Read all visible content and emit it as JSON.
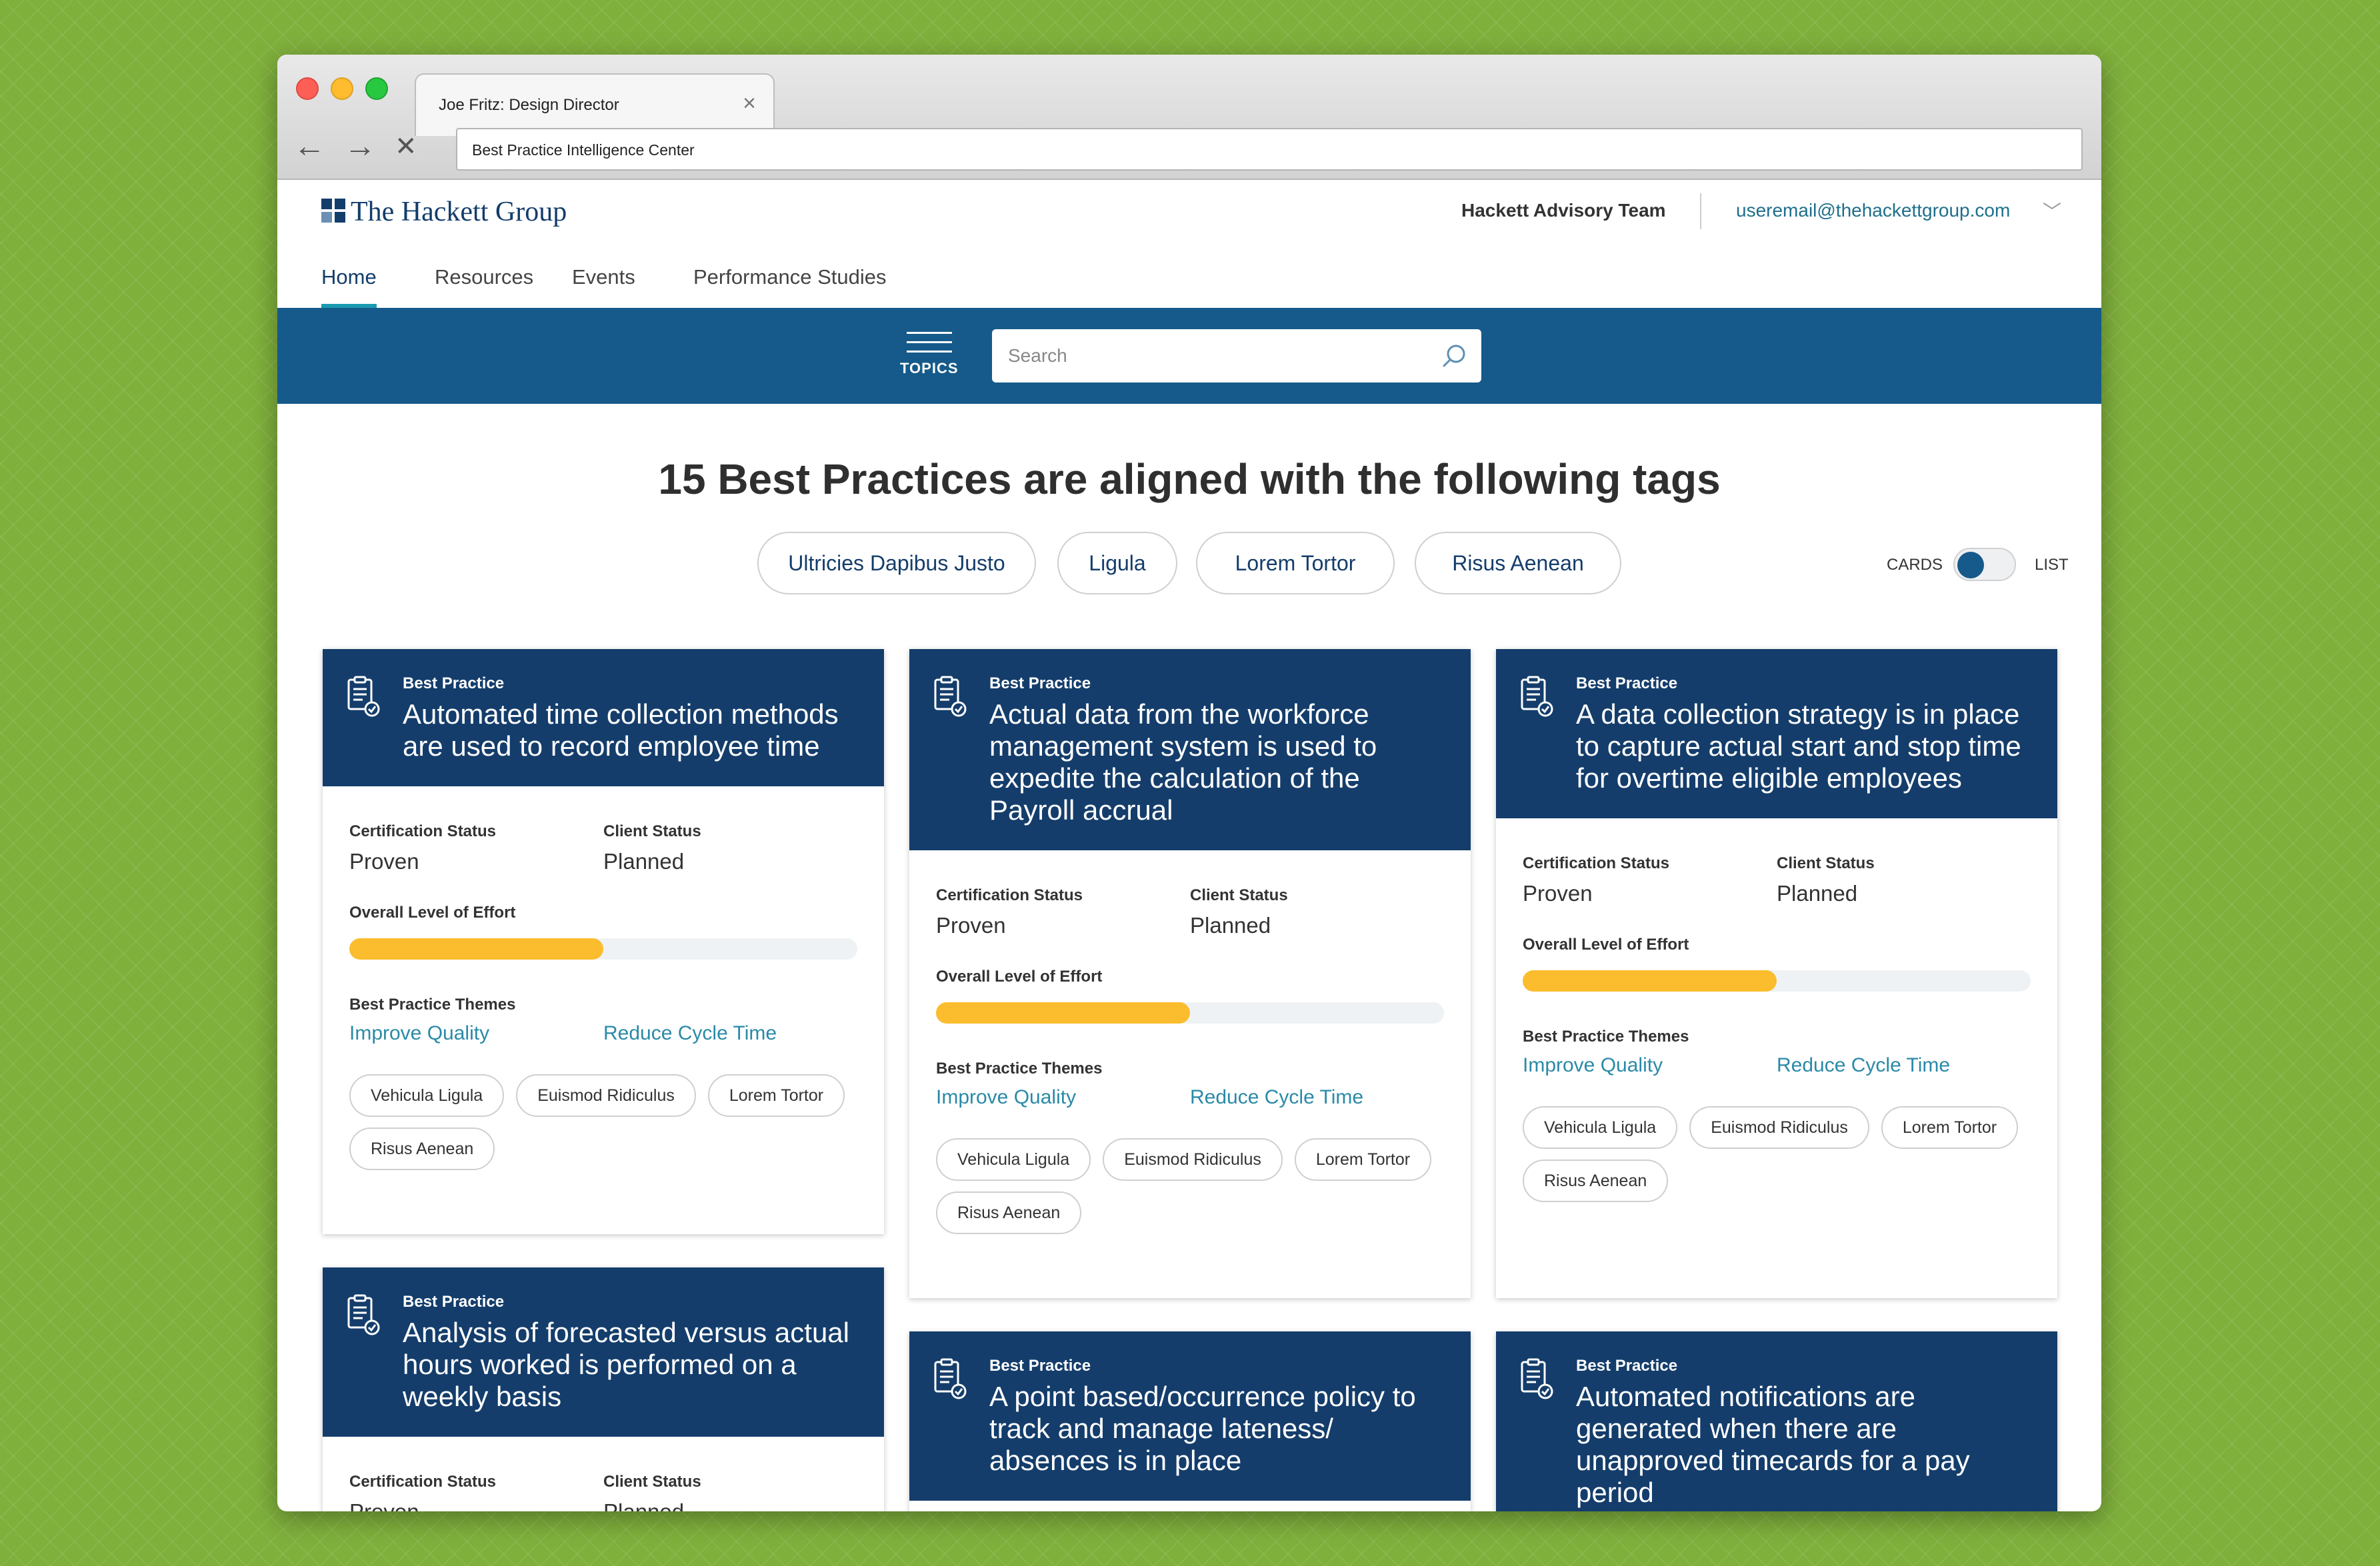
{
  "browser": {
    "tab_title": "Joe Fritz: Design Director",
    "tab_close": "×",
    "back": "←",
    "forward": "→",
    "stop": "✕",
    "address": "Best Practice Intelligence Center"
  },
  "header": {
    "logo_text": "The Hackett Group",
    "team_name": "Hackett Advisory Team",
    "user_email": "useremail@thehackettgroup.com",
    "user_chevron": "﹀"
  },
  "nav": {
    "items": [
      {
        "label": "Home",
        "active": true
      },
      {
        "label": "Resources"
      },
      {
        "label": "Events"
      },
      {
        "label": "Performance Studies"
      }
    ]
  },
  "search_band": {
    "topics_label": "TOPICS",
    "search_placeholder": "Search"
  },
  "results": {
    "heading": "15 Best Practices are aligned with the following tags",
    "tags": [
      "Ultricies Dapibus Justo",
      "Ligula",
      "Lorem Tortor",
      "Risus Aenean"
    ]
  },
  "view_toggle": {
    "cards_label": "CARDS",
    "list_label": "LIST",
    "selected": "CARDS"
  },
  "colors": {
    "brand_navy": "#143d6b",
    "band_blue": "#155a8a",
    "accent_teal": "#1a9ab0",
    "link_teal": "#2a8aa8",
    "effort_yellow": "#fbbd2e",
    "background_green": "#7fb03c"
  },
  "labels": {
    "card_type": "Best Practice",
    "cert_status": "Certification Status",
    "client_status": "Client Status",
    "effort": "Overall Level of Effort",
    "themes": "Best Practice Themes"
  },
  "cards": [
    {
      "title": "Automated time collection methods are used to record employee time",
      "certification_status": "Proven",
      "client_status": "Planned",
      "effort_level": 0.5,
      "themes": [
        "Improve Quality",
        "Reduce Cycle Time"
      ],
      "tags": [
        "Vehicula Ligula",
        "Euismod Ridiculus",
        "Lorem Tortor",
        "Risus Aenean"
      ]
    },
    {
      "title": "Actual data from the workforce management system is used to expedite the calculation of the Payroll accrual",
      "certification_status": "Proven",
      "client_status": "Planned",
      "effort_level": 0.5,
      "themes": [
        "Improve Quality",
        "Reduce Cycle Time"
      ],
      "tags": [
        "Vehicula Ligula",
        "Euismod Ridiculus",
        "Lorem Tortor",
        "Risus Aenean"
      ]
    },
    {
      "title": "A data collection strategy is in place to capture actual start and stop time for overtime eligible employees",
      "certification_status": "Proven",
      "client_status": "Planned",
      "effort_level": 0.5,
      "themes": [
        "Improve Quality",
        "Reduce Cycle Time"
      ],
      "tags": [
        "Vehicula Ligula",
        "Euismod Ridiculus",
        "Lorem Tortor",
        "Risus Aenean"
      ]
    },
    {
      "title": "Analysis of forecasted versus actual hours worked is performed on a weekly basis",
      "certification_status": "Proven",
      "client_status": "Planned"
    },
    {
      "title": "A point based/occurrence policy to track and manage lateness/ absences is in place"
    },
    {
      "title": "Automated notifications are generated when there are unapproved timecards for a pay period"
    }
  ]
}
